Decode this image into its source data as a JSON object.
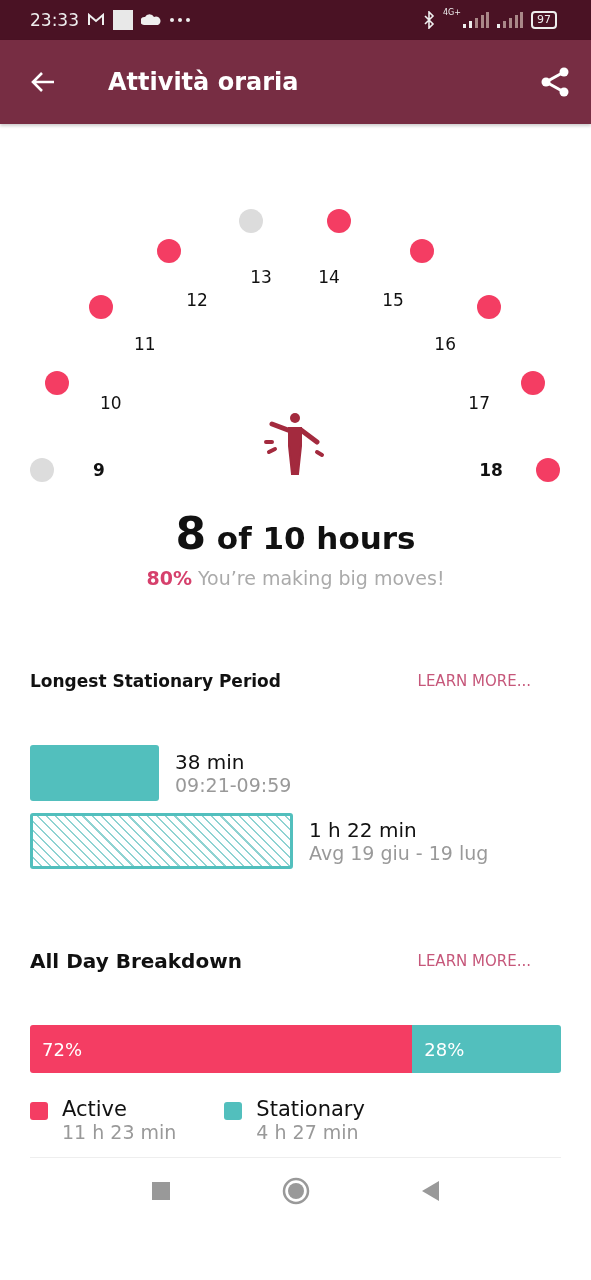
{
  "status_bar": {
    "time": "23:33",
    "battery": "97",
    "network": "4G+"
  },
  "app_bar": {
    "title": "Attività oraria"
  },
  "hourly_dial": {
    "hours": [
      {
        "label": "9",
        "active": false,
        "endpoint": true
      },
      {
        "label": "10",
        "active": true,
        "endpoint": false
      },
      {
        "label": "11",
        "active": true,
        "endpoint": false
      },
      {
        "label": "12",
        "active": true,
        "endpoint": false
      },
      {
        "label": "13",
        "active": false,
        "endpoint": false
      },
      {
        "label": "14",
        "active": true,
        "endpoint": false
      },
      {
        "label": "15",
        "active": true,
        "endpoint": false
      },
      {
        "label": "16",
        "active": true,
        "endpoint": false
      },
      {
        "label": "17",
        "active": true,
        "endpoint": false
      },
      {
        "label": "18",
        "active": true,
        "endpoint": true
      }
    ]
  },
  "summary": {
    "count": "8",
    "rest": "of 10 hours",
    "message": "**80%** You’re making big moves!"
  },
  "stationary": {
    "title": "Longest Stationary Period",
    "link": "LEARN MORE...",
    "bars": [
      {
        "kind": "solid",
        "value": "38 min",
        "detail": "09:21-09:59"
      },
      {
        "kind": "hatched",
        "value": "1 h 22 min",
        "detail": "Avg 19 giu - 19 lug"
      }
    ]
  },
  "breakdown": {
    "title": "All Day Breakdown",
    "link": "LEARN MORE...",
    "segments": [
      {
        "label": "72%",
        "color": "#f43d63"
      },
      {
        "label": "28%",
        "color": "#52bfbd"
      }
    ],
    "legend": [
      {
        "name": "Active",
        "value": "11 h 23 min",
        "color": "#f43d63"
      },
      {
        "name": "Stationary",
        "value": "4 h 27 min",
        "color": "#52bfbd"
      }
    ]
  }
}
